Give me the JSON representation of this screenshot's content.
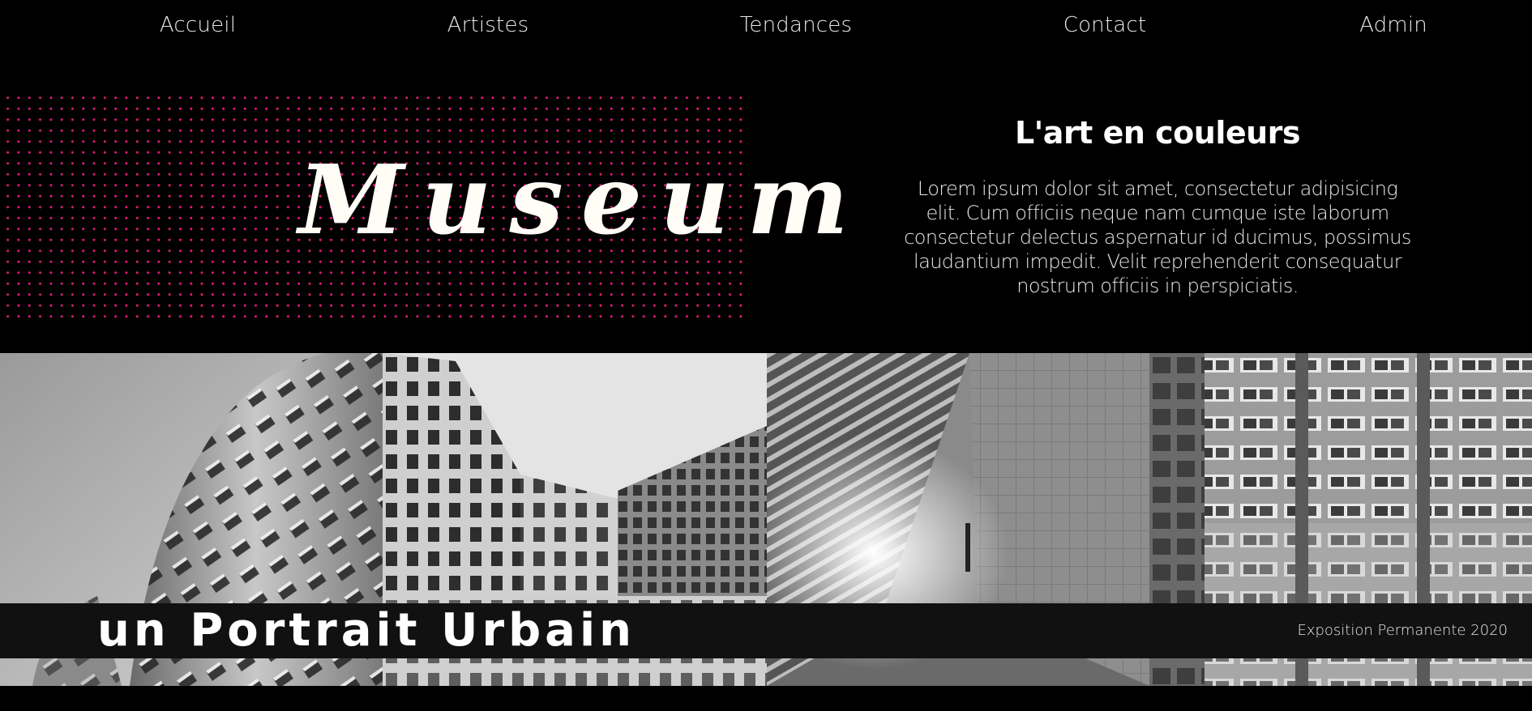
{
  "nav": {
    "items": [
      {
        "label": "Accueil"
      },
      {
        "label": "Artistes"
      },
      {
        "label": "Tendances"
      },
      {
        "label": "Contact"
      },
      {
        "label": "Admin"
      }
    ]
  },
  "hero": {
    "logo_text": "Museum",
    "title": "L'art en couleurs",
    "text": "Lorem ipsum dolor sit amet, consectetur adipisicing elit. Cum officiis neque nam cumque iste laborum consectetur delectus aspernatur id ducimus, possimus laudantium impedit. Velit reprehenderit consequatur nostrum officiis in perspiciatis."
  },
  "banner": {
    "title": "un Portrait Urbain",
    "subtitle": "Exposition Permanente 2020"
  },
  "colors": {
    "background": "#000000",
    "dot_accent": "#e0187a",
    "banner_bg": "#111111"
  }
}
